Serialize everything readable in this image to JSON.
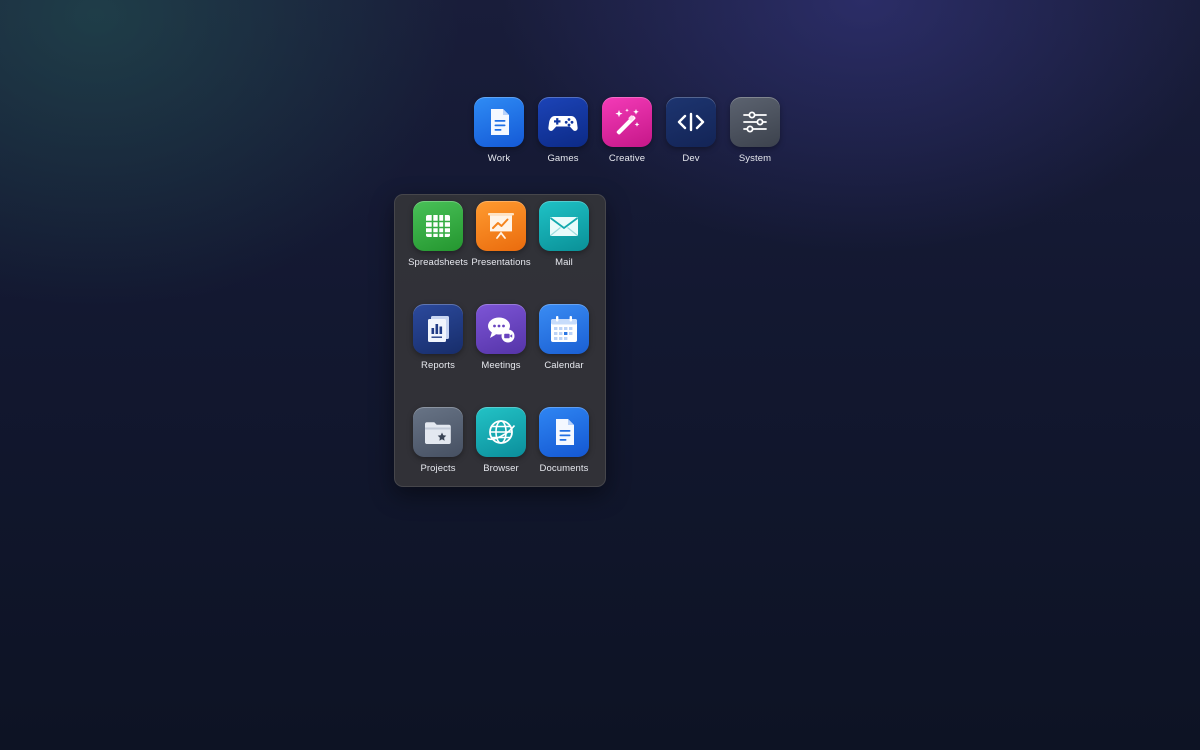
{
  "dock": {
    "items": [
      {
        "label": "Work",
        "icon": "document-icon",
        "color": "#1e6fe6"
      },
      {
        "label": "Games",
        "icon": "gamepad-icon",
        "color": "#1238a3"
      },
      {
        "label": "Creative",
        "icon": "magic-wand-icon",
        "color": "#e02aa5"
      },
      {
        "label": "Dev",
        "icon": "code-icon",
        "color": "#182d64"
      },
      {
        "label": "System",
        "icon": "sliders-icon",
        "color": "#4c535f"
      }
    ]
  },
  "folder": {
    "apps": [
      {
        "label": "Spreadsheets",
        "icon": "spreadsheet-icon",
        "color": "#34ac42"
      },
      {
        "label": "Presentations",
        "icon": "presentation-icon",
        "color": "#f5841e"
      },
      {
        "label": "Mail",
        "icon": "mail-icon",
        "color": "#12a9ae"
      },
      {
        "label": "Reports",
        "icon": "report-icon",
        "color": "#213c86"
      },
      {
        "label": "Meetings",
        "icon": "chat-video-icon",
        "color": "#6944bf"
      },
      {
        "label": "Calendar",
        "icon": "calendar-icon",
        "color": "#2a76e3"
      },
      {
        "label": "Projects",
        "icon": "folder-star-icon",
        "color": "#566174"
      },
      {
        "label": "Browser",
        "icon": "globe-icon",
        "color": "#16a8b0"
      },
      {
        "label": "Documents",
        "icon": "document-icon",
        "color": "#226fe3"
      }
    ]
  }
}
